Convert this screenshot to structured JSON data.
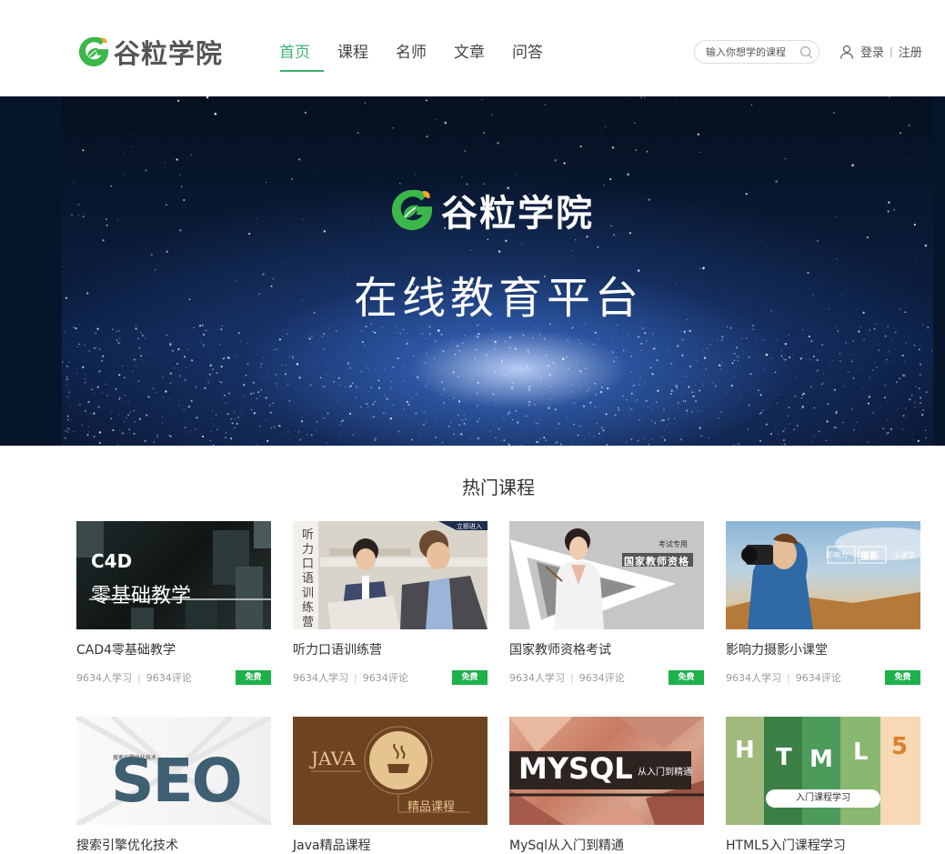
{
  "brand": {
    "name": "谷粒学院"
  },
  "nav": {
    "items": [
      "首页",
      "课程",
      "名师",
      "文章",
      "问答"
    ]
  },
  "search": {
    "placeholder": "输入你想学的课程"
  },
  "user": {
    "login": "登录",
    "separator": "|",
    "register": "注册"
  },
  "banner": {
    "brand": "谷粒学院",
    "slogan": "在线教育平台"
  },
  "section": {
    "title": "热门课程"
  },
  "courses": [
    {
      "title": "CAD4零基础教学",
      "learners": "9634人学习",
      "comments": "9634评论",
      "badge": "免费",
      "cover": {
        "line1": "C4D",
        "line2": "零基础教学"
      }
    },
    {
      "title": "听力口语训练营",
      "learners": "9634人学习",
      "comments": "9634评论",
      "badge": "免费",
      "cover": {
        "vertical": "听力口语训练营",
        "corner": "立即进入"
      }
    },
    {
      "title": "国家教师资格考试",
      "learners": "9634人学习",
      "comments": "9634评论",
      "badge": "免费",
      "cover": {
        "small": "考试专用",
        "main": "国家教师资格"
      }
    },
    {
      "title": "影响力摄影小课堂",
      "learners": "9634人学习",
      "comments": "9634评论",
      "badge": "免费",
      "cover": {
        "a": "影响力",
        "b": "摄影",
        "c": "小课堂"
      }
    },
    {
      "title": "搜索引擎优化技术",
      "cover": {
        "small": "搜索引擎优化技术",
        "main": "SEO"
      }
    },
    {
      "title": "Java精品课程",
      "cover": {
        "a": "JAVA",
        "b": "精品课程"
      }
    },
    {
      "title": "MySql从入门到精通",
      "cover": {
        "a": "MYSQL",
        "b": "从入门到精通"
      }
    },
    {
      "title": "HTML5入门课程学习",
      "cover": {
        "letters": [
          "H",
          "T",
          "M",
          "L",
          "5"
        ],
        "pill": "入门课程学习"
      }
    }
  ],
  "colors": {
    "accent": "#3cb371",
    "badge": "#1db24a"
  }
}
